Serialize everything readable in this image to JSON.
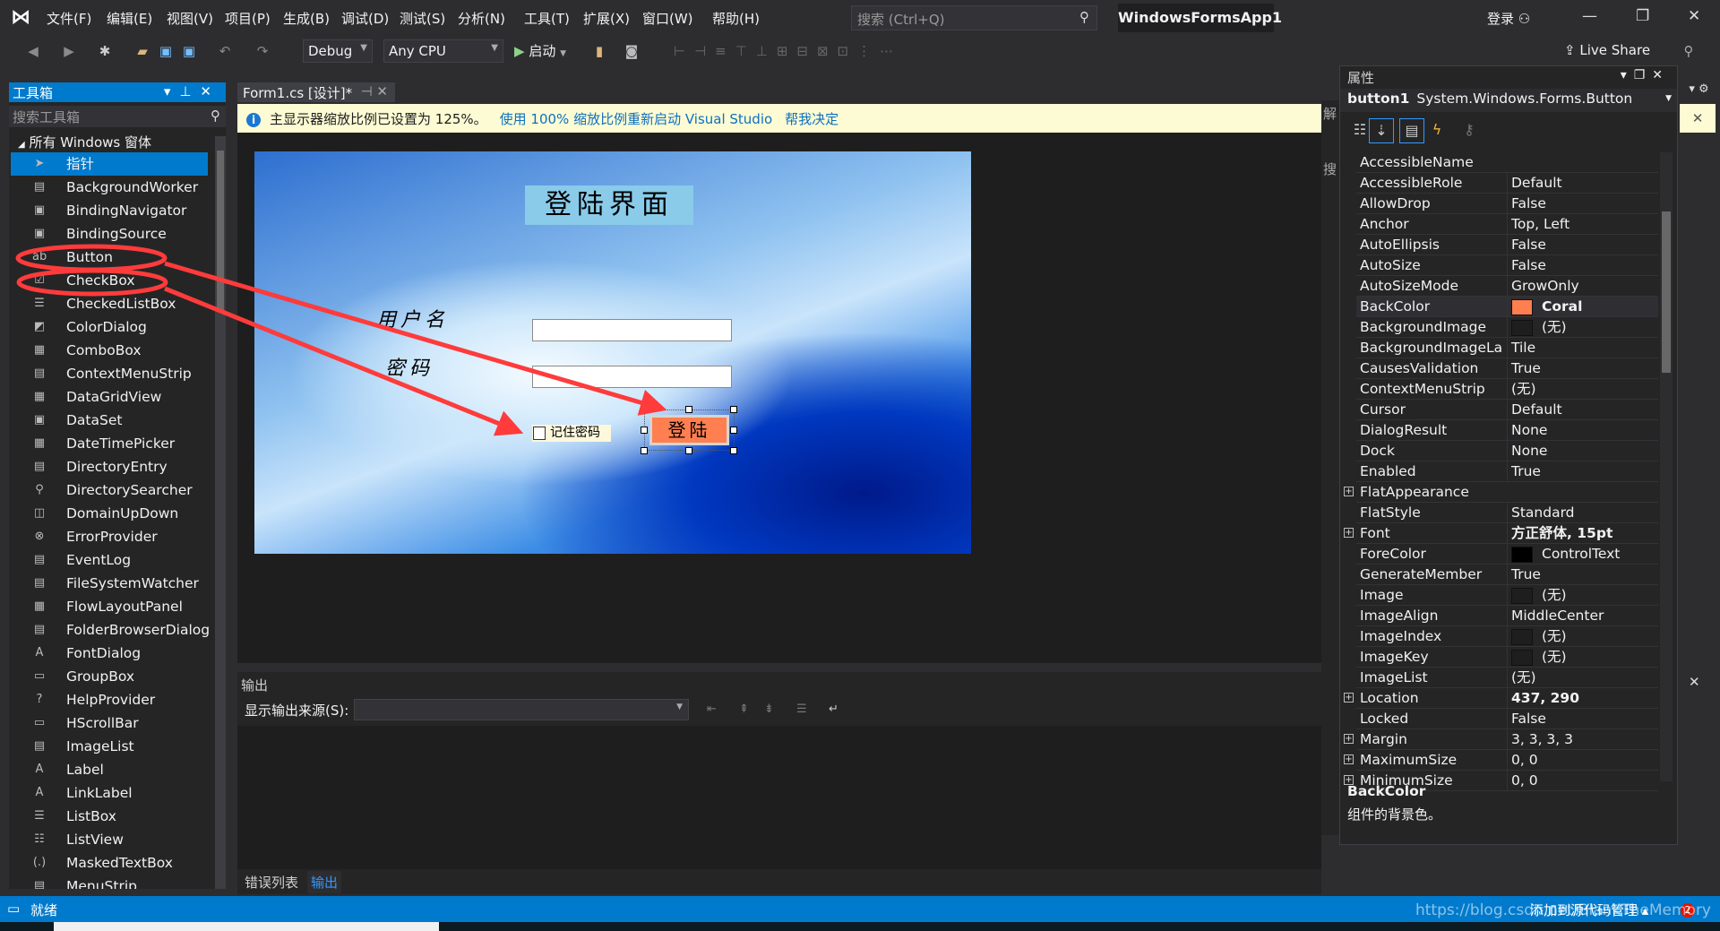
{
  "menu": [
    "文件(F)",
    "编辑(E)",
    "视图(V)",
    "项目(P)",
    "生成(B)",
    "调试(D)",
    "测试(S)",
    "分析(N)",
    "工具(T)",
    "扩展(X)",
    "窗口(W)",
    "帮助(H)"
  ],
  "search_placeholder": "搜索 (Ctrl+Q)",
  "app_title": "WindowsFormsApp1",
  "login": "登录",
  "toolbar": {
    "config": "Debug",
    "platform": "Any CPU",
    "start": "启动",
    "live_share": "Live Share"
  },
  "toolbox": {
    "title": "工具箱",
    "search_placeholder": "搜索工具箱",
    "group": "所有 Windows 窗体",
    "items": [
      {
        "label": "指针",
        "icon": "pointer-icon",
        "glyph": "➤"
      },
      {
        "label": "BackgroundWorker",
        "icon": "background-worker-icon",
        "glyph": "▤"
      },
      {
        "label": "BindingNavigator",
        "icon": "binding-navigator-icon",
        "glyph": "▣"
      },
      {
        "label": "BindingSource",
        "icon": "binding-source-icon",
        "glyph": "▣"
      },
      {
        "label": "Button",
        "icon": "button-icon",
        "glyph": "ab"
      },
      {
        "label": "CheckBox",
        "icon": "checkbox-icon",
        "glyph": "☑"
      },
      {
        "label": "CheckedListBox",
        "icon": "checked-listbox-icon",
        "glyph": "☰"
      },
      {
        "label": "ColorDialog",
        "icon": "color-dialog-icon",
        "glyph": "◩"
      },
      {
        "label": "ComboBox",
        "icon": "combobox-icon",
        "glyph": "▦"
      },
      {
        "label": "ContextMenuStrip",
        "icon": "context-menu-icon",
        "glyph": "▤"
      },
      {
        "label": "DataGridView",
        "icon": "datagrid-icon",
        "glyph": "▦"
      },
      {
        "label": "DataSet",
        "icon": "dataset-icon",
        "glyph": "▣"
      },
      {
        "label": "DateTimePicker",
        "icon": "datetime-icon",
        "glyph": "▦"
      },
      {
        "label": "DirectoryEntry",
        "icon": "directory-entry-icon",
        "glyph": "▤"
      },
      {
        "label": "DirectorySearcher",
        "icon": "directory-searcher-icon",
        "glyph": "⚲"
      },
      {
        "label": "DomainUpDown",
        "icon": "domain-updown-icon",
        "glyph": "◫"
      },
      {
        "label": "ErrorProvider",
        "icon": "error-provider-icon",
        "glyph": "⊗"
      },
      {
        "label": "EventLog",
        "icon": "eventlog-icon",
        "glyph": "▤"
      },
      {
        "label": "FileSystemWatcher",
        "icon": "filesystem-watcher-icon",
        "glyph": "▤"
      },
      {
        "label": "FlowLayoutPanel",
        "icon": "flow-layout-icon",
        "glyph": "▦"
      },
      {
        "label": "FolderBrowserDialog",
        "icon": "folder-browser-icon",
        "glyph": "▤"
      },
      {
        "label": "FontDialog",
        "icon": "font-dialog-icon",
        "glyph": "A"
      },
      {
        "label": "GroupBox",
        "icon": "groupbox-icon",
        "glyph": "▭"
      },
      {
        "label": "HelpProvider",
        "icon": "help-provider-icon",
        "glyph": "?"
      },
      {
        "label": "HScrollBar",
        "icon": "hscrollbar-icon",
        "glyph": "▭"
      },
      {
        "label": "ImageList",
        "icon": "imagelist-icon",
        "glyph": "▤"
      },
      {
        "label": "Label",
        "icon": "label-icon",
        "glyph": "A"
      },
      {
        "label": "LinkLabel",
        "icon": "linklabel-icon",
        "glyph": "A"
      },
      {
        "label": "ListBox",
        "icon": "listbox-icon",
        "glyph": "☰"
      },
      {
        "label": "ListView",
        "icon": "listview-icon",
        "glyph": "☷"
      },
      {
        "label": "MaskedTextBox",
        "icon": "masked-textbox-icon",
        "glyph": "(.)"
      },
      {
        "label": "MenuStrip",
        "icon": "menustrip-icon",
        "glyph": "▤"
      }
    ]
  },
  "document": {
    "tab": "Form1.cs [设计]*",
    "info": "主显示器缩放比例已设置为 125%。",
    "info_link1": "使用 100% 缩放比例重新启动 Visual Studio",
    "info_link2": "帮我决定",
    "form": {
      "title": "登陆界面",
      "username_label": "用户名",
      "password_label": "密码",
      "remember_label": "记住密码",
      "login_button": "登陆",
      "button_color": "#ff7f50"
    }
  },
  "output": {
    "title": "输出",
    "source_label": "显示输出来源(S):",
    "tabs": [
      "错误列表",
      "输出"
    ]
  },
  "solution_stub": [
    "解",
    "搜"
  ],
  "properties": {
    "title": "属性",
    "object_name": "button1",
    "object_type": "System.Windows.Forms.Button",
    "rows": [
      {
        "name": "AccessibleName",
        "value": ""
      },
      {
        "name": "AccessibleRole",
        "value": "Default"
      },
      {
        "name": "AllowDrop",
        "value": "False"
      },
      {
        "name": "Anchor",
        "value": "Top, Left"
      },
      {
        "name": "AutoEllipsis",
        "value": "False"
      },
      {
        "name": "AutoSize",
        "value": "False"
      },
      {
        "name": "AutoSizeMode",
        "value": "GrowOnly"
      },
      {
        "name": "BackColor",
        "value": "Coral",
        "swatch": "#ff7f50",
        "bold": true,
        "selected": true
      },
      {
        "name": "BackgroundImage",
        "value": "(无)",
        "swatch": "#1e1e1e"
      },
      {
        "name": "BackgroundImageLayout",
        "value": "Tile"
      },
      {
        "name": "CausesValidation",
        "value": "True"
      },
      {
        "name": "ContextMenuStrip",
        "value": "(无)"
      },
      {
        "name": "Cursor",
        "value": "Default"
      },
      {
        "name": "DialogResult",
        "value": "None"
      },
      {
        "name": "Dock",
        "value": "None"
      },
      {
        "name": "Enabled",
        "value": "True"
      },
      {
        "name": "FlatAppearance",
        "value": "",
        "expandable": true
      },
      {
        "name": "FlatStyle",
        "value": "Standard"
      },
      {
        "name": "Font",
        "value": "方正舒体, 15pt",
        "bold": true,
        "expandable": true
      },
      {
        "name": "ForeColor",
        "value": "ControlText",
        "swatch": "#000000"
      },
      {
        "name": "GenerateMember",
        "value": "True"
      },
      {
        "name": "Image",
        "value": "(无)",
        "swatch": "#1e1e1e"
      },
      {
        "name": "ImageAlign",
        "value": "MiddleCenter"
      },
      {
        "name": "ImageIndex",
        "value": "(无)",
        "swatch": "#1e1e1e"
      },
      {
        "name": "ImageKey",
        "value": "(无)",
        "swatch": "#1e1e1e"
      },
      {
        "name": "ImageList",
        "value": "(无)"
      },
      {
        "name": "Location",
        "value": "437, 290",
        "bold": true,
        "expandable": true
      },
      {
        "name": "Locked",
        "value": "False"
      },
      {
        "name": "Margin",
        "value": "3, 3, 3, 3",
        "expandable": true
      },
      {
        "name": "MaximumSize",
        "value": "0, 0",
        "expandable": true
      },
      {
        "name": "MinimumSize",
        "value": "0, 0",
        "expandable": true
      }
    ],
    "description_title": "BackColor",
    "description": "组件的背景色。"
  },
  "status": {
    "text": "就绪",
    "source_control": "添加到源代码管理",
    "notifications": "2"
  },
  "watermark": "https://blog.csdn.net/BlankTheMemory",
  "colors": {
    "accent": "#007acc",
    "annotation": "#ff3b3b",
    "infobar": "#fcfbd4"
  }
}
